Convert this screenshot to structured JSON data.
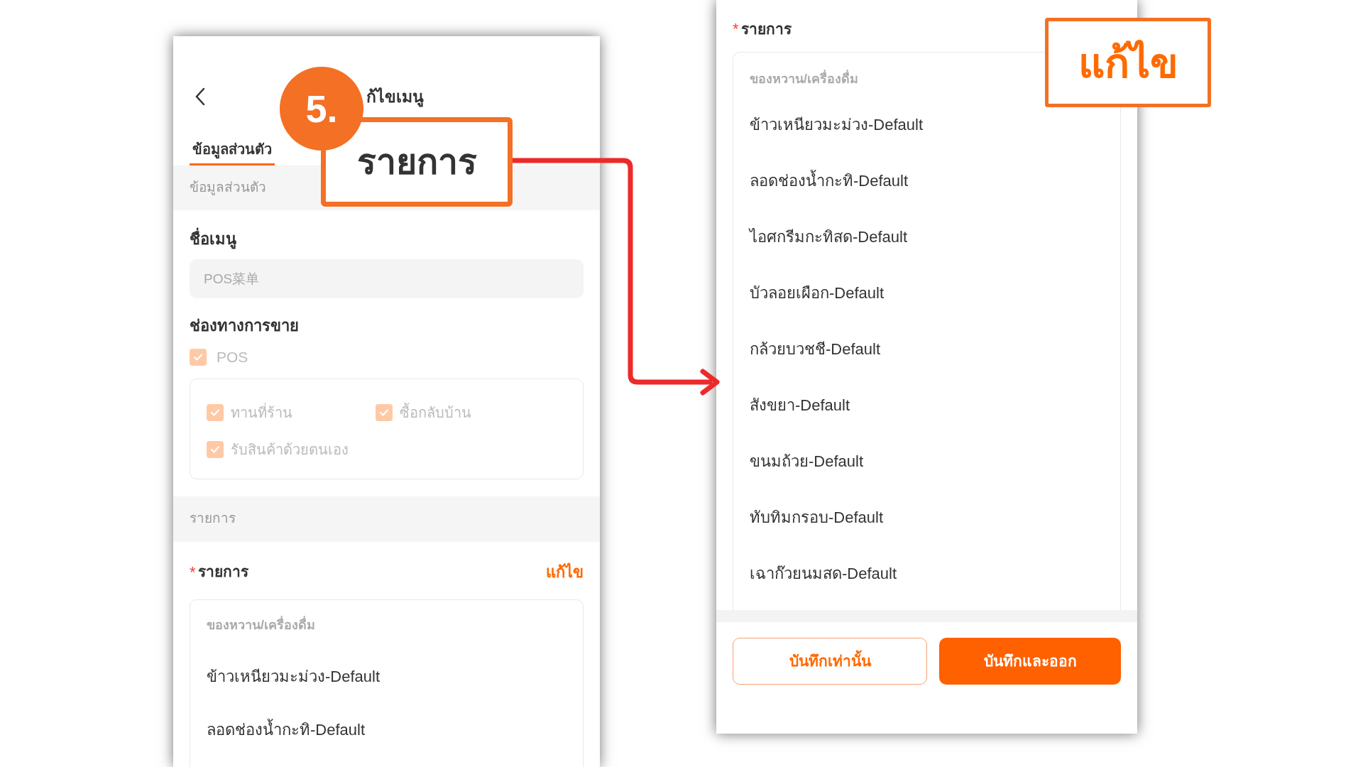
{
  "left_screen": {
    "header": {
      "title": "ก้ไขเมนู"
    },
    "tabs": [
      {
        "label": "ข้อมูลส่วนตัว",
        "selected": true
      }
    ],
    "section_personal": {
      "heading": "ข้อมูลส่วนตัว"
    },
    "menu_name": {
      "label": "ชื่อเมนู",
      "placeholder": "POS菜单"
    },
    "sales_channel": {
      "label": "ช่องทางการขาย",
      "parent": {
        "label": "POS",
        "checked": true
      },
      "options": [
        {
          "label": "ทานที่ร้าน",
          "checked": true
        },
        {
          "label": "ซื้อกลับบ้าน",
          "checked": true
        },
        {
          "label": "รับสินค้าด้วยตนเอง",
          "checked": true
        }
      ]
    },
    "section_items": {
      "heading": "รายการ"
    },
    "items_field": {
      "label": "รายการ",
      "required_mark": "*",
      "edit_link": "แก้ไข",
      "category": "ของหวาน/เครื่องดื่ม",
      "items": [
        "ข้าวเหนียวมะม่วง-Default",
        "ลอดช่องน้ำกะทิ-Default"
      ]
    }
  },
  "right_screen": {
    "items_field": {
      "label": "รายการ",
      "required_mark": "*",
      "category": "ของหวาน/เครื่องดื่ม",
      "items": [
        "ข้าวเหนียวมะม่วง-Default",
        "ลอดช่องน้ำกะทิ-Default",
        "ไอศกรีมกะทิสด-Default",
        "บัวลอยเผือก-Default",
        "กล้วยบวชชี-Default",
        "สังขยา-Default",
        "ขนมถ้วย-Default",
        "ทับทิมกรอบ-Default",
        "เฉาก๊วยนมสด-Default"
      ]
    },
    "buttons": [
      {
        "label": "บันทึกเท่านั้น",
        "kind": "outline"
      },
      {
        "label": "บันทึกและออก",
        "kind": "primary"
      }
    ]
  },
  "annotations": {
    "step_badge": "5.",
    "callouts": [
      "รายการ",
      "แก้ไข"
    ]
  }
}
